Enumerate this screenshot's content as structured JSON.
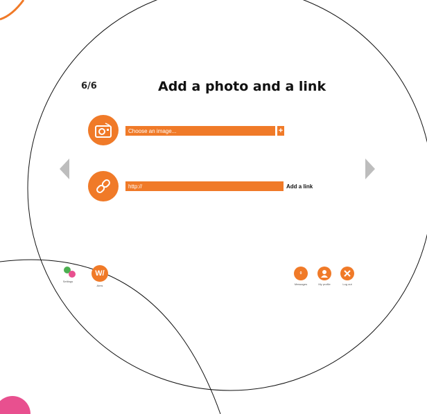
{
  "wizard": {
    "step": "6/6",
    "title": "Add a photo and a link"
  },
  "photo_row": {
    "icon": "camera-icon",
    "placeholder": "Choose an image...",
    "plus_label": "+"
  },
  "link_row": {
    "icon": "link-icon",
    "placeholder": "http://",
    "add_link_label": "Add a link"
  },
  "nav": {
    "prev_icon": "chevron-left-icon",
    "next_icon": "chevron-right-icon"
  },
  "bottom_left": {
    "settings_label": "Settings",
    "logo_text": "W/",
    "logo_caption": "Aims"
  },
  "bottom_right": {
    "messages_badge": "0",
    "messages_label": "Messages",
    "profile_label": "My profile",
    "logout_label": "Log out"
  },
  "colors": {
    "accent": "#f07a28",
    "arrow": "#bdbdbd"
  }
}
